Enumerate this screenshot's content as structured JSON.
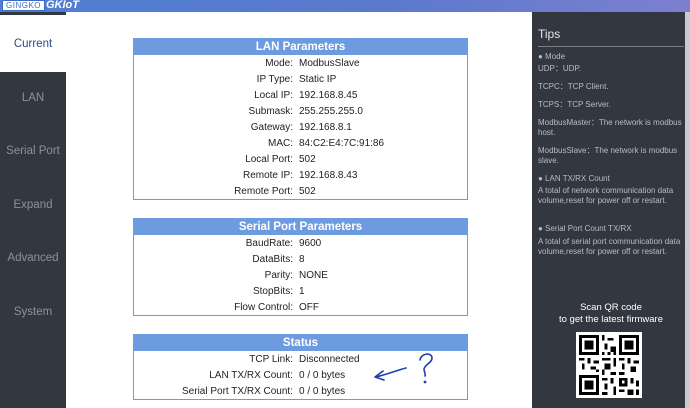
{
  "brand": {
    "logo_text": "GINGKO",
    "product": "GKIoT"
  },
  "nav": {
    "items": [
      {
        "label": "Current"
      },
      {
        "label": "LAN"
      },
      {
        "label": "Serial Port"
      },
      {
        "label": "Expand"
      },
      {
        "label": "Advanced"
      },
      {
        "label": "System"
      }
    ]
  },
  "lan": {
    "title": "LAN Parameters",
    "rows": [
      {
        "label": "Mode:",
        "value": "ModbusSlave"
      },
      {
        "label": "IP Type:",
        "value": "Static IP"
      },
      {
        "label": "Local IP:",
        "value": "192.168.8.45"
      },
      {
        "label": "Submask:",
        "value": "255.255.255.0"
      },
      {
        "label": "Gateway:",
        "value": "192.168.8.1"
      },
      {
        "label": "MAC:",
        "value": "84:C2:E4:7C:91:86"
      },
      {
        "label": "Local Port:",
        "value": "502"
      },
      {
        "label": "Remote IP:",
        "value": "192.168.8.43"
      },
      {
        "label": "Remote Port:",
        "value": "502"
      }
    ]
  },
  "serial": {
    "title": "Serial Port Parameters",
    "rows": [
      {
        "label": "BaudRate:",
        "value": "9600"
      },
      {
        "label": "DataBits:",
        "value": "8"
      },
      {
        "label": "Parity:",
        "value": "NONE"
      },
      {
        "label": "StopBits:",
        "value": "1"
      },
      {
        "label": "Flow Control:",
        "value": "OFF"
      }
    ]
  },
  "status": {
    "title": "Status",
    "rows": [
      {
        "label": "TCP Link:",
        "value": "Disconnected"
      },
      {
        "label": "LAN TX/RX Count:",
        "value": "0 / 0 bytes"
      },
      {
        "label": "Serial Port TX/RX Count:",
        "value": "0 / 0 bytes"
      }
    ]
  },
  "tips": {
    "title": "Tips",
    "items": [
      "● Mode",
      "UDP：UDP.",
      "TCPC：TCP Client.",
      "TCPS：TCP Server.",
      "ModbusMaster：The network is modbus host.",
      "ModbusSlave：The network is modbus slave.",
      "● LAN TX/RX Count",
      "A total of network communication data volume,reset for power off or restart.",
      "● Serial Port Count TX/RX",
      "A total of serial port communication data volume,reset for power off or restart."
    ],
    "qr_caption_1": "Scan QR code",
    "qr_caption_2": "to get the latest firmware"
  },
  "colors": {
    "panel_header": "#6d9be0",
    "sidebar": "#333740",
    "annotation": "#1f3fae"
  }
}
